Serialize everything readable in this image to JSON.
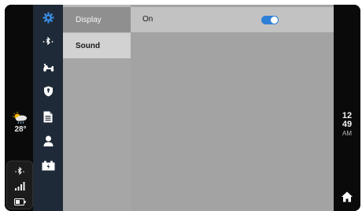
{
  "weather": {
    "icon": "partly-cloudy-rain-icon",
    "temperature": "28°"
  },
  "status": {
    "icons": [
      "bluetooth-icon",
      "signal-icon",
      "battery-icon"
    ]
  },
  "rail": {
    "items": [
      {
        "icon": "gear-icon",
        "active": true
      },
      {
        "icon": "bluetooth-icon",
        "active": false
      },
      {
        "icon": "scooter-icon",
        "active": false
      },
      {
        "icon": "shield-icon",
        "active": false
      },
      {
        "icon": "document-icon",
        "active": false
      },
      {
        "icon": "user-icon",
        "active": false
      },
      {
        "icon": "battery-charge-icon",
        "active": false
      }
    ],
    "active_color": "#3a8ee6",
    "icon_color": "#ffffff"
  },
  "submenu": {
    "items": [
      {
        "label": "Display",
        "selected": false
      },
      {
        "label": "Sound",
        "selected": true
      }
    ]
  },
  "content": {
    "rows": [
      {
        "label": "On",
        "toggle_on": true
      }
    ],
    "toggle_color": "#2e7fd6"
  },
  "clock": {
    "hour": "12",
    "minute": "49",
    "ampm": "AM"
  },
  "home": {
    "icon": "home-icon"
  }
}
